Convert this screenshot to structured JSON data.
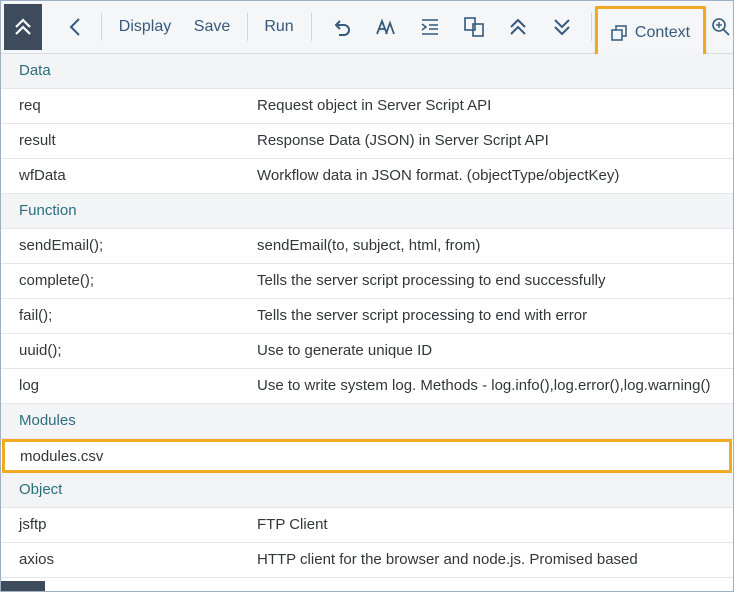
{
  "toolbar": {
    "display_label": "Display",
    "save_label": "Save",
    "run_label": "Run",
    "context_label": "Context"
  },
  "sections": [
    {
      "title": "Data",
      "rows": [
        {
          "name": "req",
          "desc": "Request object in Server Script API"
        },
        {
          "name": "result",
          "desc": "Response Data (JSON) in Server Script API"
        },
        {
          "name": "wfData",
          "desc": "Workflow data in JSON format. (objectType/objectKey)"
        }
      ]
    },
    {
      "title": "Function",
      "rows": [
        {
          "name": "sendEmail();",
          "desc": "sendEmail(to, subject, html, from)"
        },
        {
          "name": "complete();",
          "desc": "Tells the server script processing to end successfully"
        },
        {
          "name": "fail();",
          "desc": "Tells the server script processing to end with error"
        },
        {
          "name": "uuid();",
          "desc": "Use to generate unique ID"
        },
        {
          "name": "log",
          "desc": "Use to write system log. Methods - log.info(),log.error(),log.warning()"
        }
      ]
    },
    {
      "title": "Modules",
      "rows": [
        {
          "name": "modules.csv",
          "desc": ""
        }
      ]
    },
    {
      "title": "Object",
      "rows": [
        {
          "name": "jsftp",
          "desc": "FTP Client"
        },
        {
          "name": "axios",
          "desc": "HTTP client for the browser and node.js. Promised based"
        }
      ]
    }
  ]
}
